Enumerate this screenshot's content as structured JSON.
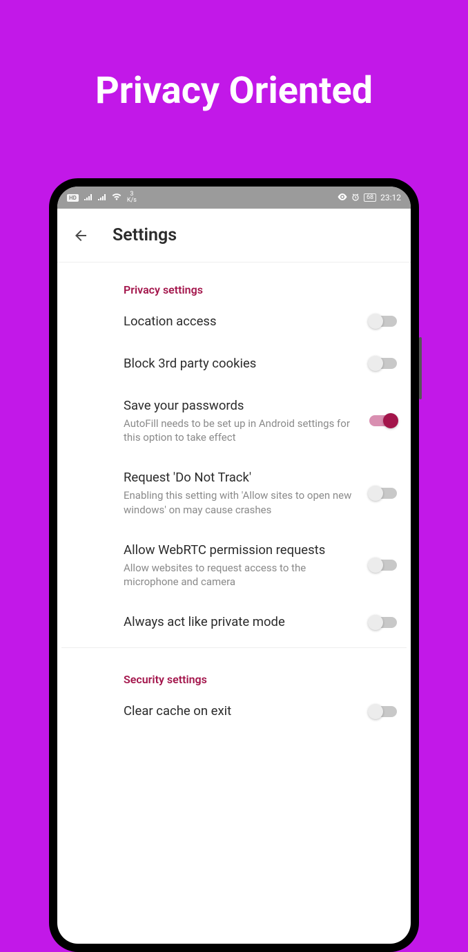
{
  "hero": {
    "title": "Privacy Oriented"
  },
  "statusBar": {
    "hd": "HD",
    "speed_top": "3",
    "speed_bottom": "K/s",
    "battery": "68",
    "time": "23:12"
  },
  "appBar": {
    "title": "Settings"
  },
  "sections": [
    {
      "header": "Privacy settings",
      "items": [
        {
          "title": "Location access",
          "sub": "",
          "on": false
        },
        {
          "title": "Block 3rd party cookies",
          "sub": "",
          "on": false
        },
        {
          "title": "Save your passwords",
          "sub": "AutoFill needs to be set up in Android settings for this option to take effect",
          "on": true
        },
        {
          "title": "Request 'Do Not Track'",
          "sub": "Enabling this setting with 'Allow sites to open new windows' on may cause crashes",
          "on": false
        },
        {
          "title": "Allow WebRTC permission requests",
          "sub": "Allow websites to request access to the microphone and camera",
          "on": false
        },
        {
          "title": "Always act like private mode",
          "sub": "",
          "on": false
        }
      ]
    },
    {
      "header": "Security settings",
      "items": [
        {
          "title": "Clear cache on exit",
          "sub": "",
          "on": false
        }
      ]
    }
  ]
}
